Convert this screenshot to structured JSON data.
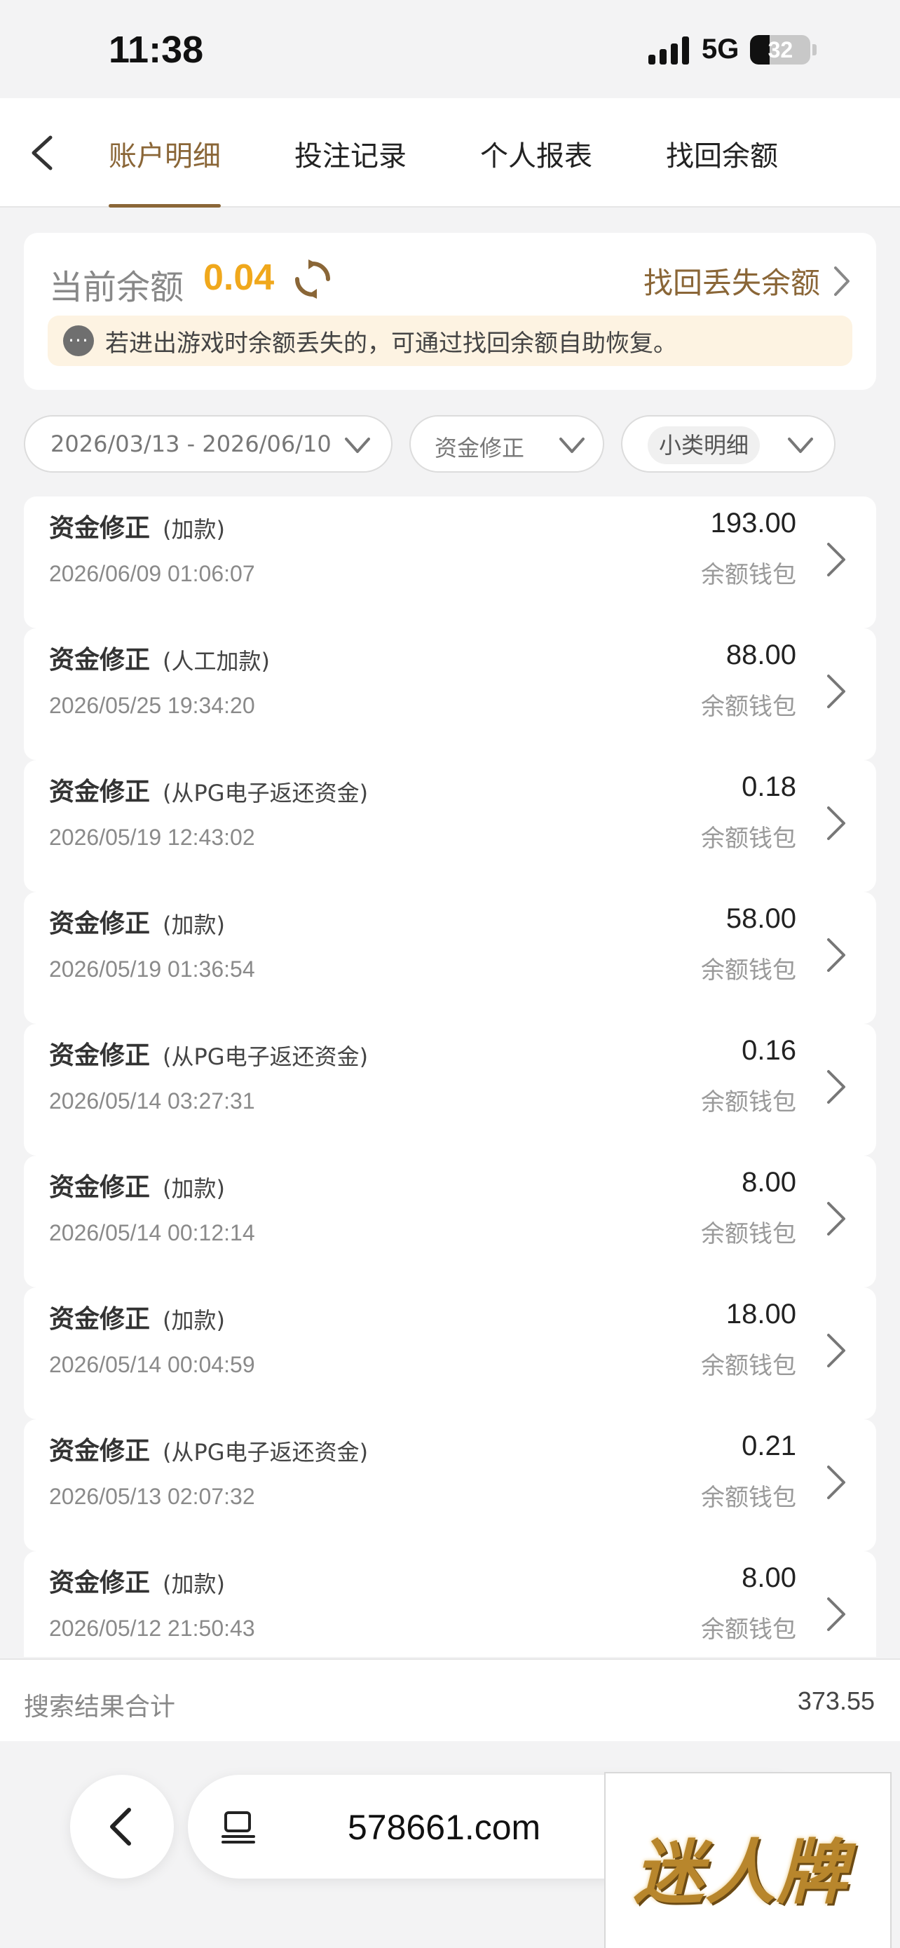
{
  "status_bar": {
    "time": "11:38",
    "network": "5G",
    "battery": "32",
    "battery_level": 32
  },
  "nav": {
    "tabs": [
      {
        "label": "账户明细",
        "active": true
      },
      {
        "label": "投注记录",
        "active": false
      },
      {
        "label": "个人报表",
        "active": false
      },
      {
        "label": "找回余额",
        "active": false
      }
    ]
  },
  "balance": {
    "label": "当前余额",
    "value": "0.04",
    "recover_label": "找回丢失余额",
    "notice": "若进出游戏时余额丢失的，可通过找回余额自助恢复。"
  },
  "filters": {
    "date_range": "2026/03/13 - 2026/06/10",
    "type": "资金修正",
    "detail": "小类明细"
  },
  "records": [
    {
      "title": "资金修正",
      "sub": "(加款)",
      "time": "2026/06/09 01:06:07",
      "amount": "193.00",
      "wallet": "余额钱包"
    },
    {
      "title": "资金修正",
      "sub": "(人工加款)",
      "time": "2026/05/25 19:34:20",
      "amount": "88.00",
      "wallet": "余额钱包"
    },
    {
      "title": "资金修正",
      "sub": "(从PG电子返还资金)",
      "time": "2026/05/19 12:43:02",
      "amount": "0.18",
      "wallet": "余额钱包"
    },
    {
      "title": "资金修正",
      "sub": "(加款)",
      "time": "2026/05/19 01:36:54",
      "amount": "58.00",
      "wallet": "余额钱包"
    },
    {
      "title": "资金修正",
      "sub": "(从PG电子返还资金)",
      "time": "2026/05/14 03:27:31",
      "amount": "0.16",
      "wallet": "余额钱包"
    },
    {
      "title": "资金修正",
      "sub": "(加款)",
      "time": "2026/05/14 00:12:14",
      "amount": "8.00",
      "wallet": "余额钱包"
    },
    {
      "title": "资金修正",
      "sub": "(加款)",
      "time": "2026/05/14 00:04:59",
      "amount": "18.00",
      "wallet": "余额钱包"
    },
    {
      "title": "资金修正",
      "sub": "(从PG电子返还资金)",
      "time": "2026/05/13 02:07:32",
      "amount": "0.21",
      "wallet": "余额钱包"
    },
    {
      "title": "资金修正",
      "sub": "(加款)",
      "time": "2026/05/12 21:50:43",
      "amount": "8.00",
      "wallet": "余额钱包"
    }
  ],
  "summary": {
    "label": "搜索结果合计",
    "value": "373.55"
  },
  "browser": {
    "url": "578661.com"
  },
  "watermark": {
    "text": "迷人牌"
  },
  "colors": {
    "accent": "#8a6637",
    "balance": "#f0a81c",
    "notice_bg": "#fdf3e2",
    "page_bg": "#f3f3f4"
  }
}
